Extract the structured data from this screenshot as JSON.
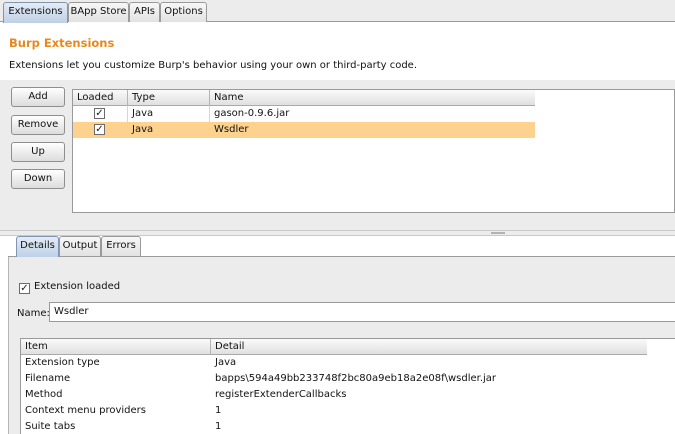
{
  "top_tabs": [
    "Extensions",
    "BApp Store",
    "APIs",
    "Options"
  ],
  "header": {
    "title": "Burp Extensions",
    "description": "Extensions let you customize Burp's behavior using your own or third-party code."
  },
  "buttons": {
    "add": "Add",
    "remove": "Remove",
    "up": "Up",
    "down": "Down"
  },
  "extensions_table": {
    "columns": [
      "Loaded",
      "Type",
      "Name"
    ],
    "rows": [
      {
        "loaded": true,
        "type": "Java",
        "name": "gason-0.9.6.jar",
        "selected": false
      },
      {
        "loaded": true,
        "type": "Java",
        "name": "Wsdler",
        "selected": true
      }
    ]
  },
  "detail_tabs": [
    "Details",
    "Output",
    "Errors"
  ],
  "details": {
    "extension_loaded_label": "Extension loaded",
    "extension_loaded": true,
    "name_label": "Name:",
    "name_value": "Wsdler",
    "table": {
      "columns": [
        "Item",
        "Detail"
      ],
      "rows": [
        {
          "item": "Extension type",
          "detail": "Java"
        },
        {
          "item": "Filename",
          "detail": "bapps\\594a49bb233748f2bc80a9eb18a2e08f\\wsdler.jar"
        },
        {
          "item": "Method",
          "detail": "registerExtenderCallbacks"
        },
        {
          "item": "Context menu providers",
          "detail": "1"
        },
        {
          "item": "Suite tabs",
          "detail": "1"
        }
      ]
    }
  },
  "colors": {
    "title_orange": "#e8891b",
    "selection": "#fdd28f",
    "active_tab": "#bfd0e6"
  },
  "icons": {
    "checkbox_checked": "✓"
  }
}
